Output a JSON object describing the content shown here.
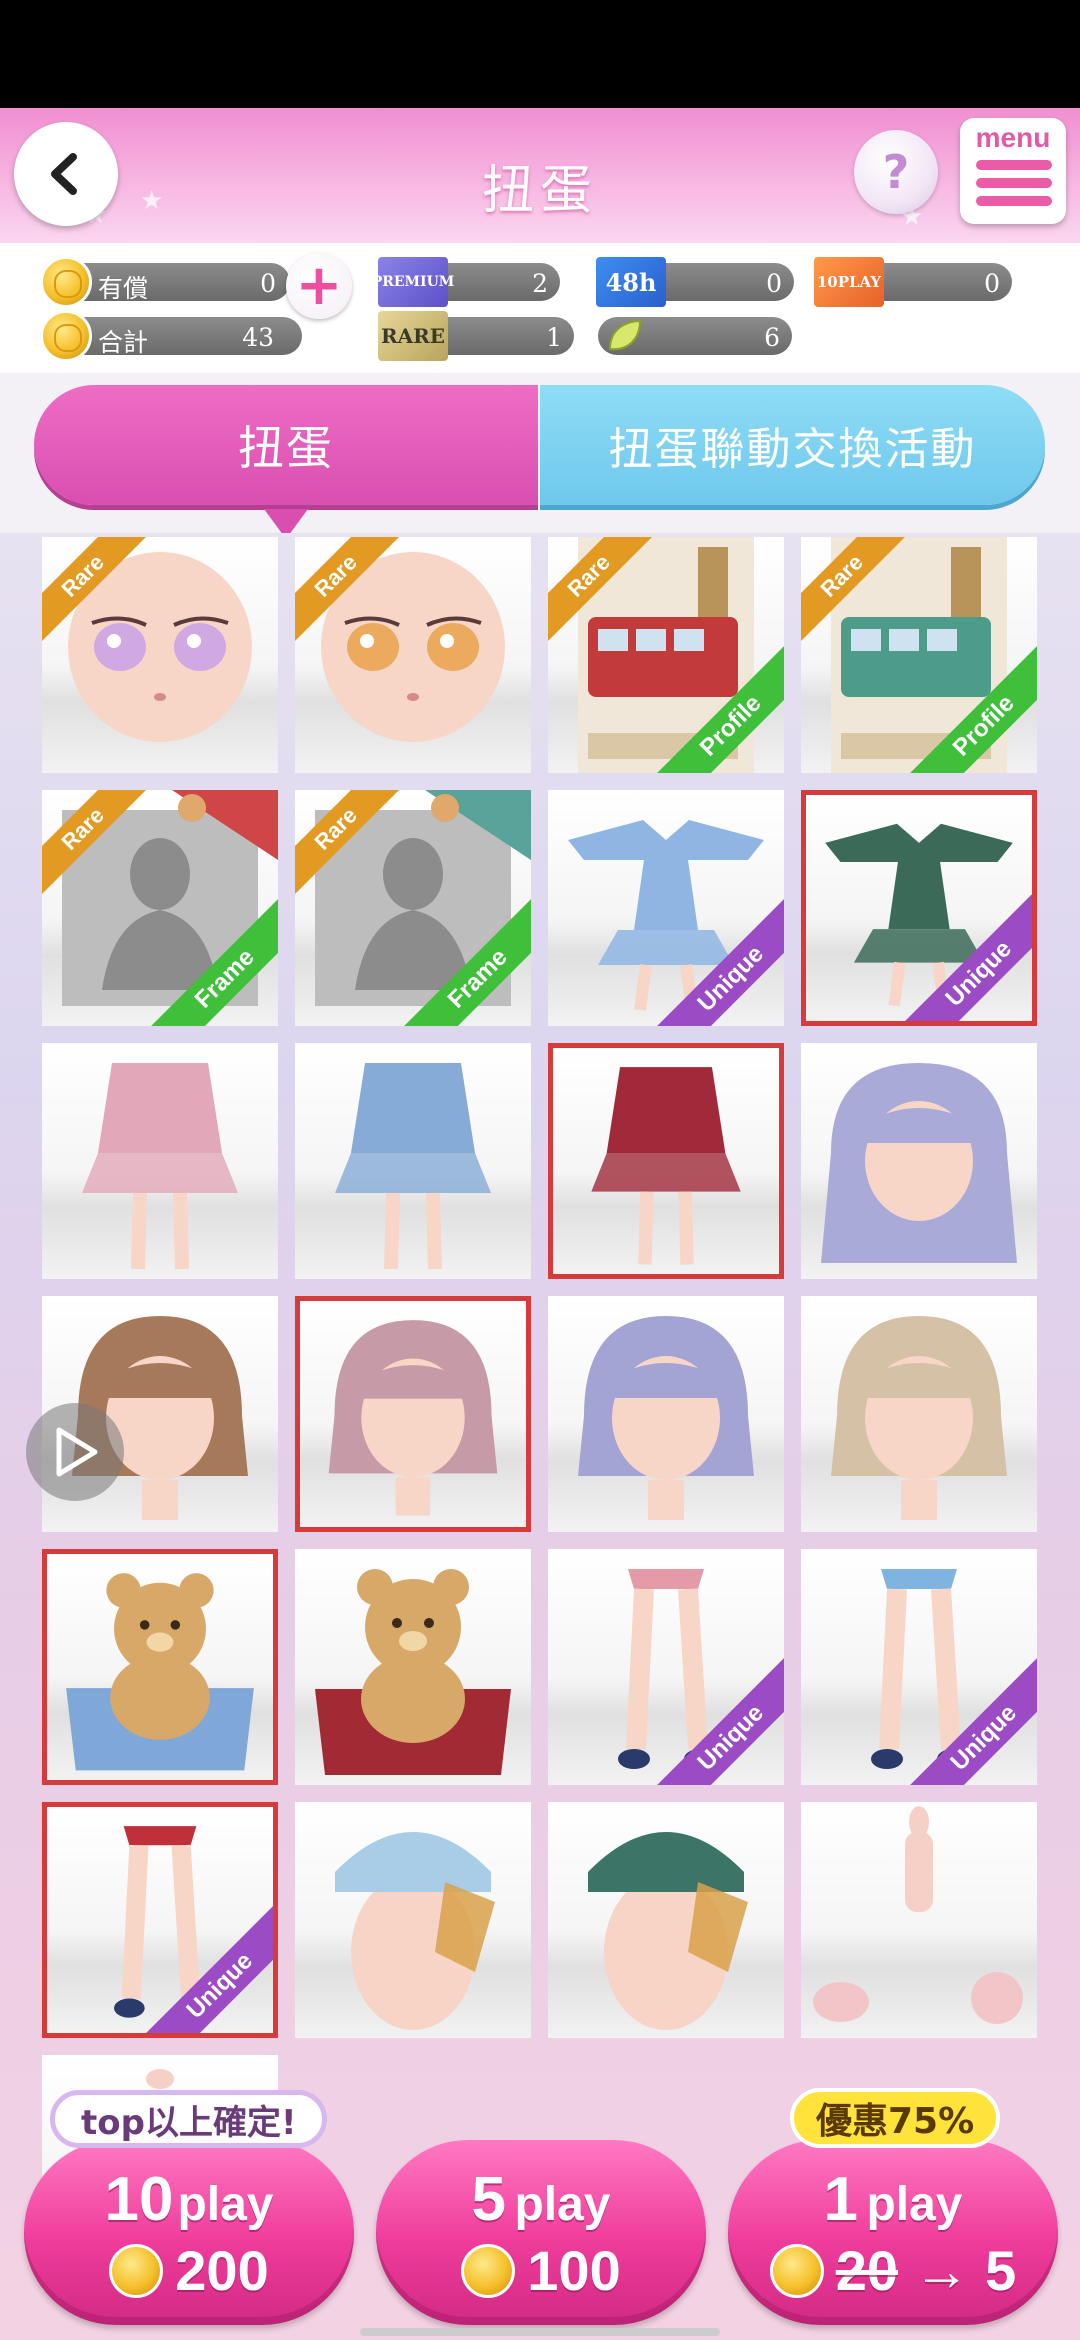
{
  "header": {
    "title": "扭蛋",
    "menu_label": "menu",
    "help_glyph": "?"
  },
  "currency": {
    "paid_label": "有償",
    "paid_value": "0",
    "total_label": "合計",
    "total_value": "43",
    "ticket_premium": {
      "label": "PREMIUM",
      "value": "2"
    },
    "ticket_48h": {
      "label": "48h",
      "value": "0"
    },
    "ticket_10play": {
      "label": "10PLAY",
      "value": "0"
    },
    "ticket_rare": {
      "label": "RARE",
      "value": "1"
    },
    "ticket_leaf": {
      "value": "6"
    }
  },
  "tabs": [
    {
      "label": "扭蛋",
      "active": true
    },
    {
      "label": "扭蛋聯動交換活動",
      "active": false
    }
  ],
  "items": [
    {
      "art": "face",
      "color": "#c9a1e8",
      "badge_rare": "Rare"
    },
    {
      "art": "face",
      "color": "#e9a24a",
      "badge_rare": "Rare"
    },
    {
      "art": "london",
      "color": "#c33a3a",
      "badge_rare": "Rare",
      "badge_tag": "Profile",
      "tag_type": "profile"
    },
    {
      "art": "london",
      "color": "#4d9c8a",
      "badge_rare": "Rare",
      "badge_tag": "Profile",
      "tag_type": "profile"
    },
    {
      "art": "frame",
      "color": "#d04545",
      "badge_rare": "Rare",
      "badge_tag": "Frame",
      "tag_type": "frame"
    },
    {
      "art": "frame",
      "color": "#5aa39a",
      "badge_rare": "Rare",
      "badge_tag": "Frame",
      "tag_type": "frame"
    },
    {
      "art": "dress",
      "color": "#8fb6e3",
      "badge_tag": "Unique",
      "tag_type": "unique"
    },
    {
      "art": "dress",
      "color": "#3b6b58",
      "badge_tag": "Unique",
      "tag_type": "unique",
      "selected": true
    },
    {
      "art": "outfit",
      "color": "#e2a7b8"
    },
    {
      "art": "outfit",
      "color": "#86abd6"
    },
    {
      "art": "outfit",
      "color": "#a02a3a",
      "selected": true
    },
    {
      "art": "hair-long",
      "color": "#a9aad8"
    },
    {
      "art": "hair",
      "color": "#a6795a"
    },
    {
      "art": "hair",
      "color": "#c79aa8",
      "selected": true
    },
    {
      "art": "hair",
      "color": "#a3a3d4"
    },
    {
      "art": "hair",
      "color": "#d4c1a6"
    },
    {
      "art": "bear",
      "color": "#7fa8d8",
      "selected": true
    },
    {
      "art": "bear",
      "color": "#a22a35"
    },
    {
      "art": "legs",
      "color": "#e59aa8",
      "badge_tag": "Unique",
      "tag_type": "unique"
    },
    {
      "art": "legs",
      "color": "#7fb4e0",
      "badge_tag": "Unique",
      "tag_type": "unique"
    },
    {
      "art": "legs",
      "color": "#c0303a",
      "badge_tag": "Unique",
      "tag_type": "unique",
      "selected": true
    },
    {
      "art": "hat",
      "color": "#a9cde6"
    },
    {
      "art": "hat",
      "color": "#3c7468"
    },
    {
      "art": "body",
      "color": "#f6d0c6"
    },
    {
      "art": "partial",
      "color": "#f6d0c6"
    }
  ],
  "play_buttons": {
    "ten": {
      "count": "10",
      "word": "play",
      "price": "200",
      "badge": "top以上確定!"
    },
    "five": {
      "count": "5",
      "word": "play",
      "price": "100"
    },
    "one": {
      "count": "1",
      "word": "play",
      "price_old": "20",
      "arrow": "→",
      "price_new": "5",
      "badge": "優惠75%"
    }
  },
  "icons": [
    "back-arrow-icon",
    "help-icon",
    "menu-icon",
    "coin-icon",
    "plus-icon",
    "premium-ticket-icon",
    "48h-ticket-icon",
    "10play-ticket-icon",
    "rare-ticket-icon",
    "leaf-icon",
    "cursor-icon"
  ],
  "colors": {
    "header_pink": "#f08fd0",
    "tab_active": "#d94fb0",
    "tab_inactive": "#6ec8ec",
    "play_button": "#ef3c9a",
    "selected_border": "#d63a3a"
  }
}
